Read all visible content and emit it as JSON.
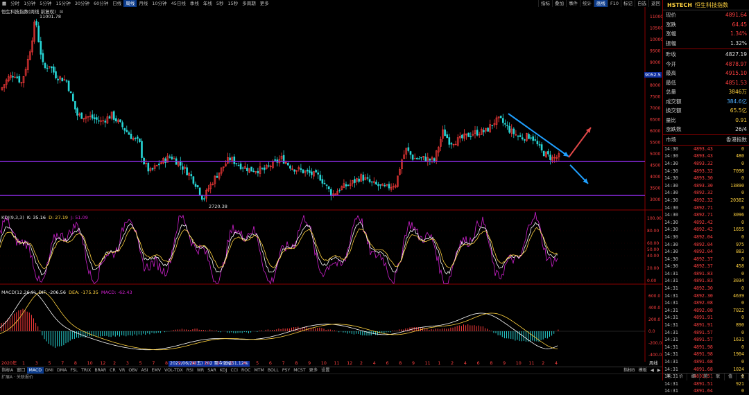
{
  "toolbar": {
    "periods": [
      "分时",
      "1分钟",
      "5分钟",
      "15分钟",
      "30分钟",
      "60分钟",
      "日线",
      "周线",
      "月线",
      "10分钟",
      "45日线",
      "季线",
      "年线",
      "5秒",
      "15秒",
      "多周期",
      "更多"
    ],
    "active_index": 7,
    "right_items": [
      "指标",
      "叠加",
      "事件",
      "统计",
      "画线",
      "F10",
      "标记",
      "自选",
      "返回"
    ],
    "active_right_index": 4,
    "first_icon": "grid-icon"
  },
  "main_panel": {
    "title": "恒生科技指数(周线 前复权)",
    "high_label": "11001.78",
    "low_label": "2720.38",
    "current_price_tag": "9052.5",
    "y_ticks": [
      "11000",
      "10500",
      "10000",
      "9500",
      "9000",
      "8500",
      "8000",
      "7500",
      "7000",
      "6500",
      "6000",
      "5500",
      "5000",
      "4500",
      "4000",
      "3500",
      "3000"
    ]
  },
  "kdj_panel": {
    "title": "KDJ(9,3,3)",
    "k": "K: 35.16",
    "d": "D: 27.19",
    "j": "J: 51.09",
    "y_ticks": [
      "100.00",
      "80.00",
      "60.00",
      "50.00",
      "40.00",
      "20.00",
      "0.00"
    ]
  },
  "macd_panel": {
    "title": "MACD(12,26,9)",
    "dif": "DIF: -206.56",
    "dea": "DEA: -175.35",
    "macd": "MACD: -62.43",
    "y_ticks": [
      "600.0",
      "400.0",
      "200.0",
      "0.0",
      "-200.0",
      "-400.0"
    ],
    "tooltip": "2022/06/24(五) 202 至今涨幅51.12%"
  },
  "date_axis": {
    "start": "2020年",
    "labels": [
      "1",
      "3",
      "5",
      "7",
      "8",
      "10",
      "12",
      "2",
      "3",
      "5",
      "7",
      "8",
      "9",
      "10",
      "12",
      "2",
      "3",
      "4",
      "5",
      "6",
      "7",
      "8",
      "9",
      "10",
      "11",
      "12",
      "2",
      "4",
      "6",
      "8",
      "9",
      "11",
      "1",
      "2",
      "4",
      "6",
      "8",
      "9",
      "10",
      "11",
      "2",
      "4"
    ],
    "right_label": "周线"
  },
  "indicators": {
    "items": [
      "指标A",
      "窗口",
      "MACD",
      "DMI",
      "DMA",
      "FSL",
      "TRIX",
      "BRAR",
      "CR",
      "VR",
      "OBV",
      "ASI",
      "EMV",
      "VOL-TDX",
      "RSI",
      "WR",
      "SAR",
      "KDJ",
      "CCI",
      "ROC",
      "MTM",
      "BOLL",
      "PSY",
      "MCST",
      "更多",
      "设置"
    ],
    "active_index": 2,
    "right_items": [
      "指标B",
      "模板",
      "◀",
      "▶"
    ]
  },
  "status": {
    "text": "扩展A · 关联报价"
  },
  "quote": {
    "code": "HSTECH",
    "name": "恒生科技指数",
    "rows_top": [
      {
        "label": "现价",
        "value": "4891.64",
        "color": "#ff4040"
      },
      {
        "label": "涨跌",
        "value": "64.45",
        "color": "#ff4040"
      },
      {
        "label": "涨幅",
        "value": "1.34%",
        "color": "#ff4040"
      },
      {
        "label": "振幅",
        "value": "1.32%",
        "color": "#e0e0e0"
      }
    ],
    "rows_mid": [
      {
        "label": "昨收",
        "value": "4827.19",
        "color": "#e0e0e0"
      },
      {
        "label": "今开",
        "value": "4878.97",
        "color": "#ff4040"
      },
      {
        "label": "最高",
        "value": "4915.10",
        "color": "#ff4040"
      },
      {
        "label": "最低",
        "value": "4851.53",
        "color": "#ff4040"
      },
      {
        "label": "总量",
        "value": "3846万",
        "color": "#ffd23f"
      },
      {
        "label": "成交额",
        "value": "384.6亿",
        "color": "#4fb0ff"
      },
      {
        "label": "换交额",
        "value": "65.5亿",
        "color": "#ffd23f"
      },
      {
        "label": "量比",
        "value": "0.91",
        "color": "#ffd23f"
      },
      {
        "label": "涨跌数",
        "value": "26/4",
        "color": "#e0e0e0"
      }
    ],
    "market_label": "市场",
    "market_value": "香港指数",
    "ticks": [
      {
        "t": "14:30",
        "p": "4893.43",
        "v": "0"
      },
      {
        "t": "14:30",
        "p": "4893.43",
        "v": "480"
      },
      {
        "t": "14:30",
        "p": "4893.32",
        "v": "0"
      },
      {
        "t": "14:30",
        "p": "4893.32",
        "v": "7098"
      },
      {
        "t": "14:30",
        "p": "4893.30",
        "v": "0"
      },
      {
        "t": "14:30",
        "p": "4893.30",
        "v": "13890"
      },
      {
        "t": "14:30",
        "p": "4892.32",
        "v": "0"
      },
      {
        "t": "14:30",
        "p": "4892.32",
        "v": "20382"
      },
      {
        "t": "14:30",
        "p": "4892.71",
        "v": "0"
      },
      {
        "t": "14:30",
        "p": "4892.71",
        "v": "3096"
      },
      {
        "t": "14:30",
        "p": "4892.42",
        "v": "0"
      },
      {
        "t": "14:30",
        "p": "4892.42",
        "v": "1655"
      },
      {
        "t": "14:30",
        "p": "4892.04",
        "v": "0"
      },
      {
        "t": "14:30",
        "p": "4892.04",
        "v": "975"
      },
      {
        "t": "14:30",
        "p": "4892.04",
        "v": "883"
      },
      {
        "t": "14:30",
        "p": "4892.37",
        "v": "0"
      },
      {
        "t": "14:30",
        "p": "4892.37",
        "v": "458"
      },
      {
        "t": "14:31",
        "p": "4891.83",
        "v": "0"
      },
      {
        "t": "14:31",
        "p": "4891.83",
        "v": "3034"
      },
      {
        "t": "14:31",
        "p": "4892.30",
        "v": "0"
      },
      {
        "t": "14:31",
        "p": "4892.30",
        "v": "4639"
      },
      {
        "t": "14:31",
        "p": "4892.08",
        "v": "0"
      },
      {
        "t": "14:31",
        "p": "4892.08",
        "v": "7022"
      },
      {
        "t": "14:31",
        "p": "4891.91",
        "v": "0"
      },
      {
        "t": "14:31",
        "p": "4891.91",
        "v": "890"
      },
      {
        "t": "14:31",
        "p": "4891.57",
        "v": "0"
      },
      {
        "t": "14:31",
        "p": "4891.57",
        "v": "1631"
      },
      {
        "t": "14:31",
        "p": "4891.98",
        "v": "0"
      },
      {
        "t": "14:31",
        "p": "4891.98",
        "v": "1904"
      },
      {
        "t": "14:31",
        "p": "4891.68",
        "v": "0"
      },
      {
        "t": "14:31",
        "p": "4891.68",
        "v": "1024"
      },
      {
        "t": "14:31",
        "p": "4891.51",
        "v": "0"
      },
      {
        "t": "14:31",
        "p": "4891.51",
        "v": "921"
      },
      {
        "t": "14:31",
        "p": "4891.64",
        "v": "0"
      }
    ],
    "bottom_tabs": [
      "笔",
      "价",
      "细",
      "势",
      "联",
      "值",
      "主"
    ]
  },
  "colors": {
    "up": "#ff3b3b",
    "down": "#27d6d6",
    "support_line": "#8a2be2",
    "arrow_down": "#1fa0ff",
    "arrow_up": "#e04848",
    "k_line": "#ffffff",
    "d_line": "#ffd23f",
    "j_line": "#d020d0"
  }
}
